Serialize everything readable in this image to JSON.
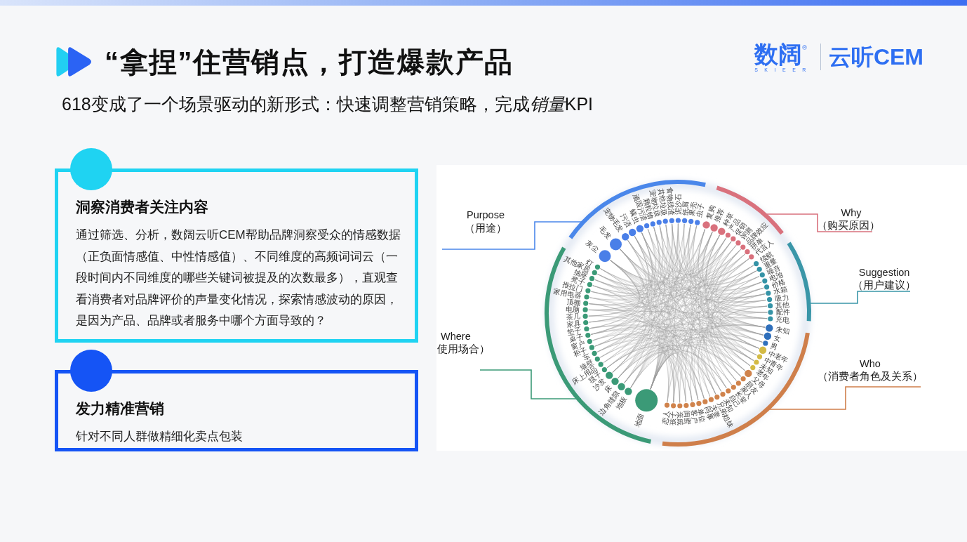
{
  "header": {
    "title": "“拿捏”住营销点，打造爆款产品",
    "subtitle": [
      {
        "text": "618变成了一个场景驱动的新形式：快速调整营销策略，完成",
        "italic": false
      },
      {
        "text": "销量",
        "italic": true
      },
      {
        "text": "KPI",
        "italic": false
      }
    ]
  },
  "logo": {
    "brand": "数阔$^{®}$",
    "tagline": "SKIEER",
    "product": "云听CEM"
  },
  "cards": [
    {
      "title": "洞察消费者关注内容",
      "text": "通过筛选、分析，数阔云听CEM帮助品牌洞察受众的情感数据（正负面情感值、中性情感值）、不同维度的高频词词云（一段时间内不同维度的哪些关键词被提及的次数最多），直观查看消费者对品牌评价的声量变化情况，探索情感波动的原因，是因为产品、品牌或者服务中哪个方面导致的？",
      "color": "#1fd3f2"
    },
    {
      "title": "发力精准营销",
      "text": "针对不同人群做精细化卖点包装",
      "color": "#1554f5"
    }
  ],
  "chord": {
    "groups": [
      {
        "label": "Purpose",
        "sublabel": "（用途）",
        "color": "#4a87ea",
        "clusters": [
          {
            "color": "#4a7fe8",
            "nodes": [
              {
                "label": "灰尘",
                "kind": "large"
              },
              {
                "label": "毛发",
                "kind": "large"
              },
              {
                "label": "宠物毛发",
                "kind": "medium"
              },
              {
                "label": "污渍",
                "kind": "medium"
              },
              {
                "label": "螨虫",
                "kind": "medium"
              },
              {
                "label": "顽固污渍",
                "kind": "small"
              },
              {
                "label": "颗粒物",
                "kind": "small"
              },
              {
                "label": "宠物垃圾",
                "kind": "small"
              },
              {
                "label": "其他垃圾",
                "kind": "small"
              },
              {
                "label": "食物残渣",
                "kind": "small"
              },
              {
                "label": "泥沙石",
                "kind": "small"
              },
              {
                "label": "纸屑",
                "kind": "small"
              },
              {
                "label": "果壳",
                "kind": "small"
              },
              {
                "label": "虫子",
                "kind": "small"
              }
            ]
          }
        ]
      },
      {
        "label": "Why",
        "sublabel": "（购买原因）",
        "color": "#d9717d",
        "clusters": [
          {
            "color": "#d9717d",
            "nodes": [
              {
                "label": "复购",
                "kind": "medium"
              },
              {
                "label": "推荐",
                "kind": "medium"
              },
              {
                "label": "种草",
                "kind": "medium"
              },
              {
                "label": "产品",
                "kind": "small"
              },
              {
                "label": "促销",
                "kind": "small"
              },
              {
                "label": "评测",
                "kind": "small"
              },
              {
                "label": "品牌效应",
                "kind": "small"
              },
              {
                "label": "拼单",
                "kind": "small"
              },
              {
                "label": "代言人",
                "kind": "small"
              }
            ]
          }
        ]
      },
      {
        "label": "Suggestion",
        "sublabel": "（用户建议）",
        "color": "#3a96a8",
        "clusters": [
          {
            "color": "#3593a6",
            "nodes": [
              {
                "label": "续航",
                "kind": "small"
              },
              {
                "label": "重量",
                "kind": "small"
              },
              {
                "label": "噪音",
                "kind": "small"
              },
              {
                "label": "电池",
                "kind": "small"
              },
              {
                "label": "价格",
                "kind": "small"
              },
              {
                "label": "水箱",
                "kind": "small"
              },
              {
                "label": "吸力",
                "kind": "small"
              },
              {
                "label": "其他",
                "kind": "small"
              },
              {
                "label": "配件",
                "kind": "small"
              },
              {
                "label": "充电",
                "kind": "small"
              }
            ]
          }
        ]
      },
      {
        "label": "Who",
        "sublabel": "（消费者角色及关系）",
        "color": "#cf7f4b",
        "clusters": [
          {
            "color": "#2f6fbb",
            "nodes": [
              {
                "label": "未知",
                "kind": "medium"
              },
              {
                "label": "女",
                "kind": "medium"
              },
              {
                "label": "男",
                "kind": "small"
              }
            ]
          },
          {
            "color": "#d4bb45",
            "nodes": [
              {
                "label": "中老年",
                "kind": "medium"
              },
              {
                "label": "中青年",
                "kind": "small"
              },
              {
                "label": "未知",
                "kind": "small"
              },
              {
                "label": "老年",
                "kind": "small"
              }
            ]
          },
          {
            "color": "#d0834c",
            "nodes": [
              {
                "label": "父母",
                "kind": "medium"
              },
              {
                "label": "朋友",
                "kind": "small"
              },
              {
                "label": "家人",
                "kind": "small"
              },
              {
                "label": "长辈",
                "kind": "small"
              },
              {
                "label": "自己",
                "kind": "small"
              },
              {
                "label": "未知",
                "kind": "small"
              },
              {
                "label": "兄弟姐妹",
                "kind": "small"
              },
              {
                "label": "夫妻",
                "kind": "small"
              },
              {
                "label": "同事",
                "kind": "small"
              },
              {
                "label": "单位",
                "kind": "small"
              },
              {
                "label": "客户",
                "kind": "small"
              },
              {
                "label": "闺蜜",
                "kind": "small"
              },
              {
                "label": "亲戚",
                "kind": "small"
              },
              {
                "label": "孩子",
                "kind": "small"
              },
              {
                "label": "恋人",
                "kind": "small"
              }
            ]
          }
        ]
      },
      {
        "label": "Where",
        "sublabel": "使用场合）",
        "color": "#3b9a77",
        "clusters": [
          {
            "color": "#3b9a77",
            "nodes": [
              {
                "label": "地面",
                "kind": "xlarge"
              },
              {
                "label": "地板",
                "kind": "medium"
              },
              {
                "label": "边角缝隙",
                "kind": "medium"
              },
              {
                "label": "床",
                "kind": "medium"
              },
              {
                "label": "沙发",
                "kind": "medium"
              },
              {
                "label": "毯子",
                "kind": "small"
              },
              {
                "label": "床上用品",
                "kind": "small"
              },
              {
                "label": "墙壁",
                "kind": "small"
              },
              {
                "label": "车",
                "kind": "small"
              },
              {
                "label": "柜子",
                "kind": "small"
              },
              {
                "label": "窗户",
                "kind": "small"
              },
              {
                "label": "桌子",
                "kind": "small"
              },
              {
                "label": "垫子",
                "kind": "small"
              },
              {
                "label": "家具",
                "kind": "small"
              },
              {
                "label": "茶几",
                "kind": "small"
              },
              {
                "label": "电脑",
                "kind": "small"
              },
              {
                "label": "顶棚",
                "kind": "small"
              },
              {
                "label": "家用电器",
                "kind": "small"
              },
              {
                "label": "推拉门",
                "kind": "small"
              },
              {
                "label": "凳子",
                "kind": "small"
              },
              {
                "label": "抽屉",
                "kind": "small"
              },
              {
                "label": "其他家居",
                "kind": "small"
              },
              {
                "label": "灯",
                "kind": "small"
              }
            ]
          }
        ]
      }
    ]
  }
}
